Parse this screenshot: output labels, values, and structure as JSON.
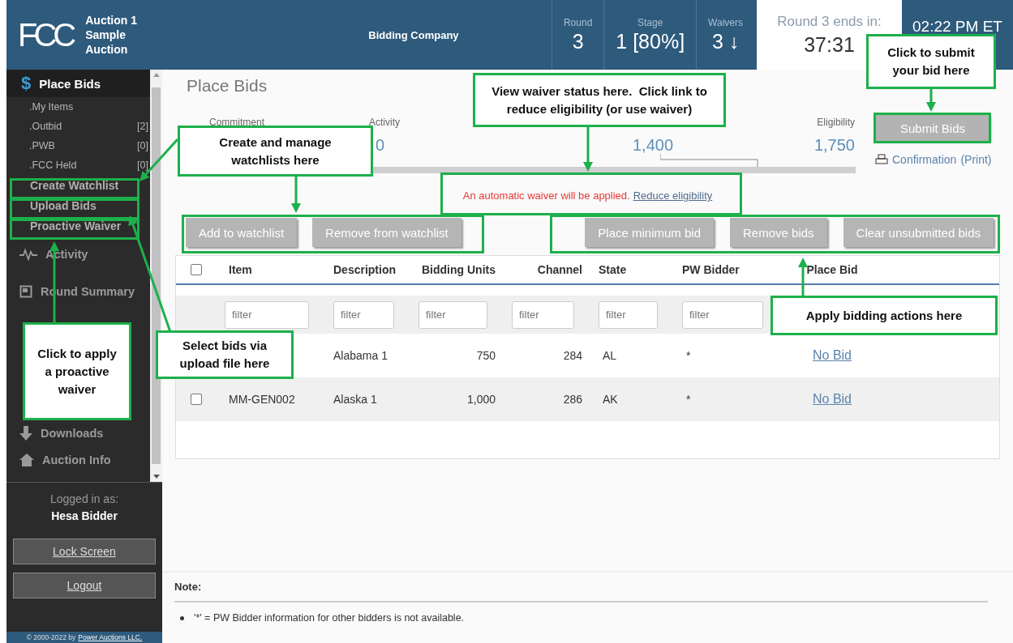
{
  "header": {
    "logo": "FCC",
    "auction_line1": "Auction 1",
    "auction_line2": "Sample Auction",
    "company": "Bidding Company",
    "stats": [
      {
        "label": "Round",
        "value": "3"
      },
      {
        "label": "Stage",
        "value": "1 [80%]"
      },
      {
        "label": "Waivers",
        "value": "3 ↓"
      }
    ],
    "countdown": {
      "label": "Round 3 ends in:",
      "value": "37:31"
    },
    "clock": "02:22 PM ET"
  },
  "sidebar": {
    "section": {
      "icon": "$",
      "label": "Place Bids",
      "selected": true
    },
    "sub_items": [
      {
        "kind": "filter",
        "label": ".My Items"
      },
      {
        "kind": "filter",
        "label": ".Outbid",
        "count": "[2]"
      },
      {
        "kind": "filter",
        "label": ".PWB",
        "count": "[0]"
      },
      {
        "kind": "filter",
        "label": ".FCC Held",
        "count": "[0]"
      },
      {
        "kind": "action",
        "label": "Create Watchlist"
      },
      {
        "kind": "action",
        "label": "Upload Bids"
      },
      {
        "kind": "action",
        "label": "Proactive Waiver"
      }
    ],
    "items": [
      {
        "label": "Activity"
      },
      {
        "label": "Round Summary"
      },
      {
        "label": "Downloads"
      },
      {
        "label": "Auction Info"
      }
    ],
    "logged_in_label": "Logged in as:",
    "user": "Hesa Bidder",
    "buttons": [
      "Lock Screen",
      "Logout"
    ],
    "footer_text": "© 2000-2022 by",
    "footer_link": "Power Auctions LLC."
  },
  "main": {
    "title": "Place Bids",
    "metrics": [
      {
        "label": "Commitment"
      },
      {
        "label": "Activity",
        "value": "0"
      },
      {
        "value": "1,400"
      },
      {
        "label": "Eligibility",
        "value": "1,750"
      }
    ],
    "submit_button": "Submit Bids",
    "confirmation_link": "Confirmation",
    "print_link": "(Print)",
    "waiver_message": "An automatic waiver will be applied.",
    "waiver_link": "Reduce eligibility",
    "left_buttons": [
      "Add to watchlist",
      "Remove from watchlist"
    ],
    "right_buttons": [
      "Place minimum bid",
      "Remove bids",
      "Clear unsubmitted bids"
    ],
    "table": {
      "select_all_checked": false,
      "columns": [
        "Item",
        "Description",
        "Bidding Units",
        "Channel",
        "State",
        "PW Bidder",
        "Place Bid"
      ],
      "filter_placeholders": [
        "filter",
        "filter",
        "filter",
        "filter",
        "filter",
        "filter"
      ],
      "rows": [
        {
          "description": "Alabama 1",
          "bidding_units": "750",
          "channel": "284",
          "state": "AL",
          "pw_bidder": "*",
          "place_bid": "No Bid"
        },
        {
          "checked": false,
          "item": "MM-GEN002",
          "description": "Alaska 1",
          "bidding_units": "1,000",
          "channel": "286",
          "state": "AK",
          "pw_bidder": "*",
          "place_bid": "No Bid"
        }
      ]
    },
    "note_title": "Note:",
    "notes": [
      "'*' = PW Bidder information for other bidders is not available."
    ]
  },
  "callouts": [
    {
      "text": "Click to submit your bid here"
    },
    {
      "text": "View waiver status here.  Click link to reduce eligibility (or use waiver)"
    },
    {
      "text": "Create and manage watchlists here"
    },
    {
      "text": "Click to apply a proactive waiver"
    },
    {
      "text": "Select bids via upload file here"
    },
    {
      "text": "Apply bidding actions here"
    }
  ]
}
